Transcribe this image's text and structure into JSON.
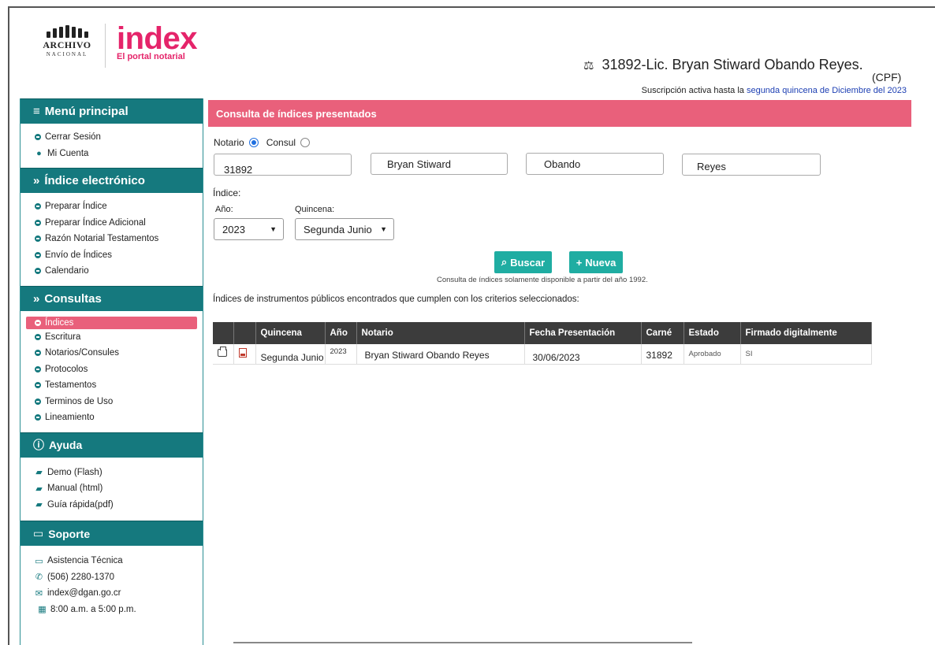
{
  "header": {
    "archivo_word": "ARCHIVO",
    "archivo_sub": "NACIONAL",
    "index_logo": "index",
    "index_tagline": "El portal notarial",
    "user_line": "31892-Lic. Bryan Stiward Obando Reyes.",
    "cpf": "(CPF)",
    "subscription_prefix": "Suscripción activa hasta la",
    "subscription_link": "segunda quincena de Diciembre del 2023"
  },
  "sidebar": {
    "menu_title": "Menú principal",
    "menu_items": [
      "Cerrar Sesión",
      "Mi Cuenta"
    ],
    "indice_title": "Índice electrónico",
    "indice_items": [
      "Preparar Índice",
      "Preparar Índice Adicional",
      "Razón Notarial Testamentos",
      "Envío de Índices",
      "Calendario"
    ],
    "consultas_title": "Consultas",
    "consultas_items": [
      "Índices",
      "Escritura",
      "Notarios/Consules",
      "Protocolos",
      "Testamentos",
      "Terminos de Uso",
      "Lineamiento"
    ],
    "ayuda_title": "Ayuda",
    "ayuda_items": [
      "Demo (Flash)",
      "Manual (html)",
      "Guía rápida(pdf)"
    ],
    "soporte_title": "Soporte",
    "soporte_items": [
      "Asistencia Técnica",
      "(506) 2280-1370",
      "index@dgan.go.cr",
      "8:00 a.m. a 5:00 p.m."
    ]
  },
  "main": {
    "title": "Consulta de índices presentados",
    "radio_notario": "Notario",
    "radio_consul": "Consul",
    "field_carne": "31892",
    "field_nombre": "Bryan Stiward",
    "field_apellido1": "Obando",
    "field_apellido2": "Reyes",
    "label_indice": "Índice:",
    "label_anio": "Año:",
    "label_quincena": "Quincena:",
    "select_anio": "2023",
    "select_quincena": "Segunda Junio",
    "btn_buscar": "Buscar",
    "btn_nueva": "Nueva",
    "note": "Consulta de índices solamente disponible a partir del año 1992.",
    "found_text": "Índices de instrumentos públicos encontrados que cumplen con los criterios seleccionados:"
  },
  "table": {
    "headers": [
      "",
      "",
      "Quincena",
      "Año",
      "Notario",
      "Fecha Presentación",
      "Carné",
      "Estado",
      "Firmado digitalmente"
    ],
    "rows": [
      {
        "quincena": "Segunda Junio",
        "anio": "2023",
        "notario": "Bryan Stiward Obando Reyes",
        "fecha": "30/06/2023",
        "carne": "31892",
        "estado": "Aprobado",
        "firmado": "SI"
      }
    ]
  }
}
